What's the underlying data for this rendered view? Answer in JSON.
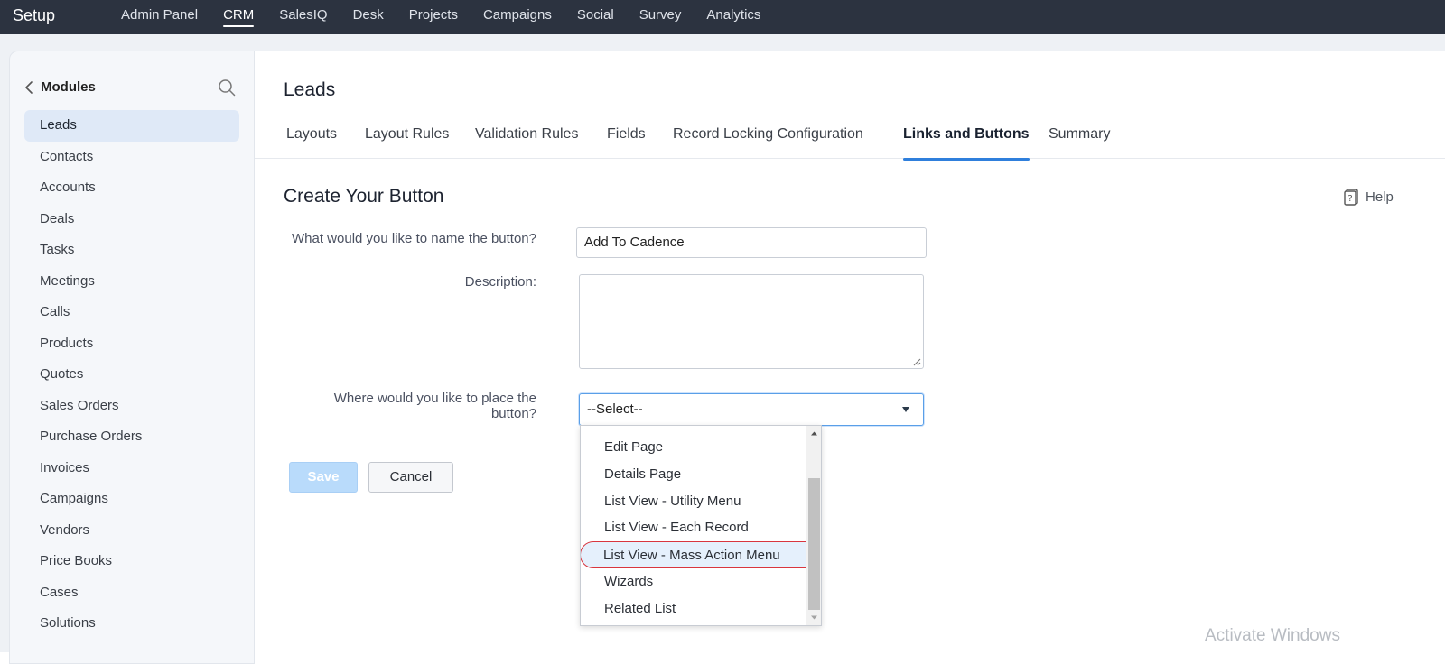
{
  "topbar": {
    "brand": "Setup",
    "nav": [
      "Admin Panel",
      "CRM",
      "SalesIQ",
      "Desk",
      "Projects",
      "Campaigns",
      "Social",
      "Survey",
      "Analytics"
    ],
    "active": "CRM"
  },
  "sidebar": {
    "title": "Modules",
    "items": [
      "Leads",
      "Contacts",
      "Accounts",
      "Deals",
      "Tasks",
      "Meetings",
      "Calls",
      "Products",
      "Quotes",
      "Sales Orders",
      "Purchase Orders",
      "Invoices",
      "Campaigns",
      "Vendors",
      "Price Books",
      "Cases",
      "Solutions"
    ],
    "active": "Leads"
  },
  "main": {
    "module_title": "Leads",
    "tabs": [
      "Layouts",
      "Layout Rules",
      "Validation Rules",
      "Fields",
      "Record Locking Configuration",
      "Links and Buttons",
      "Summary"
    ],
    "active_tab": "Links and Buttons",
    "section_title": "Create Your Button",
    "help_label": "Help"
  },
  "form": {
    "name_label": "What would you like to name the button?",
    "name_value": "Add To Cadence",
    "description_label": "Description:",
    "placement_label_line1": "Where would you like to place the",
    "placement_label_line2": "button?",
    "placement_selected": "--Select--",
    "placement_options": [
      "Edit Page",
      "Details Page",
      "List View - Utility Menu",
      "List View - Each Record",
      "List View - Mass Action Menu",
      "Wizards",
      "Related List"
    ],
    "highlighted_option": "List View - Mass Action Menu",
    "save_label": "Save",
    "cancel_label": "Cancel"
  },
  "watermark": "Activate Windows",
  "colors": {
    "topbar_bg": "#2c3340",
    "accent": "#2f7fdc",
    "sidebar_active_bg": "#dfe9f7",
    "highlight_outline": "#d9363e",
    "save_button_bg": "#b9dbfb"
  }
}
